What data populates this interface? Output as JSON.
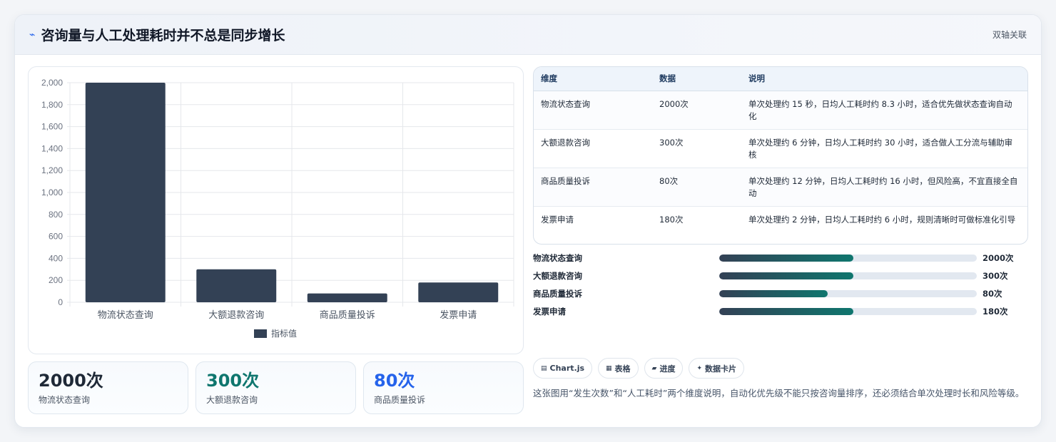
{
  "header": {
    "title": "咨询量与人工处理耗时并不总是同步增长",
    "tag": "双轴关联",
    "icon": "bolt-icon"
  },
  "chart_data": {
    "type": "bar",
    "categories": [
      "物流状态查询",
      "大额退款咨询",
      "商品质量投诉",
      "发票申请"
    ],
    "series": [
      {
        "name": "指标值",
        "values": [
          2000,
          300,
          80,
          180
        ]
      }
    ],
    "ylim": [
      0,
      2000
    ],
    "yticks": [
      "0",
      "200",
      "400",
      "600",
      "800",
      "1,000",
      "1,200",
      "1,400",
      "1,600",
      "1,800",
      "2,000"
    ],
    "legend": "bottom",
    "grid": true,
    "bar_color": "#334155"
  },
  "kpis": [
    {
      "value": "2000次",
      "label": "物流状态查询",
      "color": "#1f2937"
    },
    {
      "value": "300次",
      "label": "大额退款咨询",
      "color": "#0f766e"
    },
    {
      "value": "80次",
      "label": "商品质量投诉",
      "color": "#2563eb"
    }
  ],
  "table": {
    "headers": [
      "维度",
      "数据",
      "说明"
    ],
    "rows": [
      [
        "物流状态查询",
        "2000次",
        "单次处理约 15 秒，日均人工耗时约 8.3 小时，适合优先做状态查询自动化"
      ],
      [
        "大额退款咨询",
        "300次",
        "单次处理约 6 分钟，日均人工耗时约 30 小时，适合做人工分流与辅助审核"
      ],
      [
        "商品质量投诉",
        "80次",
        "单次处理约 12 分钟，日均人工耗时约 16 小时，但风险高，不宜直接全自动"
      ],
      [
        "发票申请",
        "180次",
        "单次处理约 2 分钟，日均人工耗时约 6 小时，规则清晰时可做标准化引导"
      ]
    ]
  },
  "progress": [
    {
      "label": "物流状态查询",
      "value": "2000次",
      "fill": 0.52
    },
    {
      "label": "大额退款咨询",
      "value": "300次",
      "fill": 0.52
    },
    {
      "label": "商品质量投诉",
      "value": "80次",
      "fill": 0.42
    },
    {
      "label": "发票申请",
      "value": "180次",
      "fill": 0.52
    }
  ],
  "pills": [
    {
      "label": "Chart.js",
      "icon": "▤"
    },
    {
      "label": "表格",
      "icon": "▦"
    },
    {
      "label": "进度",
      "icon": "▰"
    },
    {
      "label": "数据卡片",
      "icon": "✦"
    }
  ],
  "note": "这张图用“发生次数”和“人工耗时”两个维度说明，自动化优先级不能只按咨询量排序，还必须结合单次处理时长和风险等级。"
}
